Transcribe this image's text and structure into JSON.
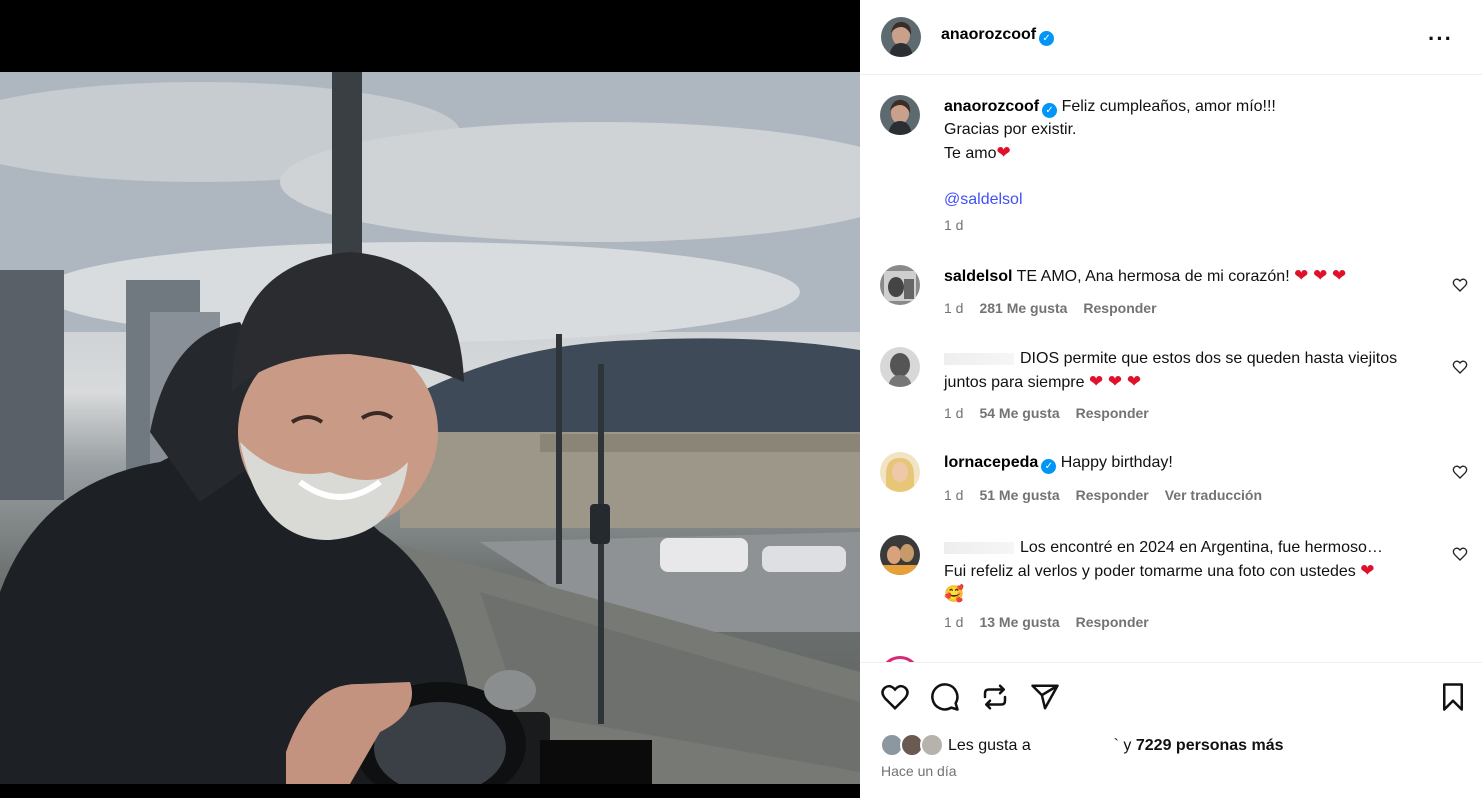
{
  "post": {
    "author": "anaorozcoof",
    "caption_line1": "Feliz cumpleaños, amor mío!!!",
    "caption_line2": "Gracias por existir.",
    "caption_line3": "Te amo",
    "mention": "@saldelsol",
    "age": "1 d"
  },
  "comments": [
    {
      "user": "saldelsol",
      "text": "TE AMO, Ana hermosa de mi corazón!",
      "hearts": "❤ ❤ ❤",
      "age": "1 d",
      "likes": "281 Me gusta",
      "reply": "Responder"
    },
    {
      "user": "",
      "text": "DIOS permite que estos dos se queden hasta viejitos",
      "text2": "juntos para siempre",
      "hearts": "❤ ❤ ❤",
      "age": "1 d",
      "likes": "54 Me gusta",
      "reply": "Responder"
    },
    {
      "user": "lornacepeda",
      "text": "Happy birthday!",
      "age": "1 d",
      "likes": "51 Me gusta",
      "reply": "Responder",
      "translate": "Ver traducción"
    },
    {
      "user": "",
      "text": "Los encontré en 2024 en Argentina, fue hermoso…",
      "text2": "Fui refeliz al verlos y poder tomarme una foto con ustedes",
      "heart": "❤",
      "emoji": "🥰",
      "age": "1 d",
      "likes": "13 Me gusta",
      "reply": "Responder"
    }
  ],
  "footer": {
    "likes_prefix": "Les gusta a",
    "likes_suffix": "` y",
    "likes_count": "7229 personas más",
    "time": "Hace un día"
  },
  "icons": {
    "like": "heart-icon",
    "comment": "comment-icon",
    "share_repost": "repost-icon",
    "send": "send-icon",
    "save": "bookmark-icon",
    "more": "more-options-icon"
  },
  "colors": {
    "verified": "#0095f6",
    "mention": "#4150f7",
    "heart": "#e0102a",
    "muted": "#737373"
  }
}
